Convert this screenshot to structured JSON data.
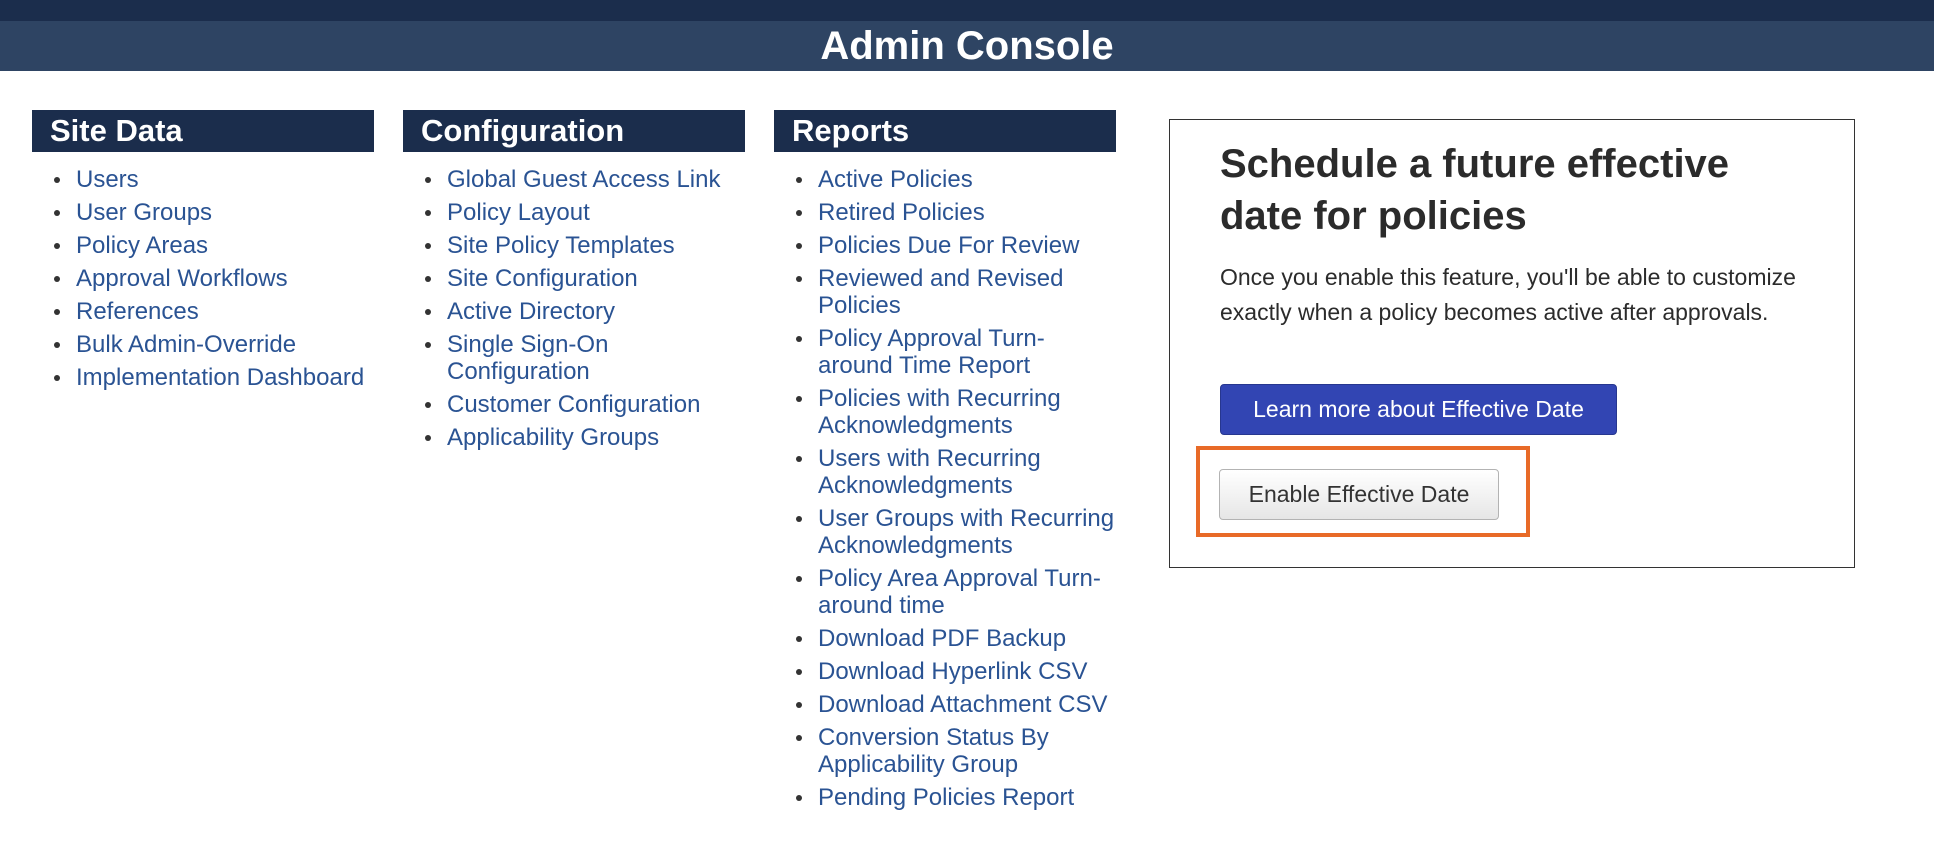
{
  "header": {
    "title": "Admin Console"
  },
  "site_data": {
    "heading": "Site Data",
    "items": [
      {
        "label": "Users"
      },
      {
        "label": "User Groups"
      },
      {
        "label": "Policy Areas"
      },
      {
        "label": "Approval Workflows"
      },
      {
        "label": "References"
      },
      {
        "label": "Bulk Admin-Override"
      },
      {
        "label": "Implementation Dashboard"
      }
    ]
  },
  "configuration": {
    "heading": "Configuration",
    "items": [
      {
        "label": "Global Guest Access Link"
      },
      {
        "label": "Policy Layout"
      },
      {
        "label": "Site Policy Templates"
      },
      {
        "label": "Site Configuration"
      },
      {
        "label": "Active Directory"
      },
      {
        "label": "Single Sign-On Configuration"
      },
      {
        "label": "Customer Configuration"
      },
      {
        "label": "Applicability Groups"
      }
    ]
  },
  "reports": {
    "heading": "Reports",
    "items": [
      {
        "label": "Active Policies"
      },
      {
        "label": "Retired Policies"
      },
      {
        "label": "Policies Due For Review"
      },
      {
        "label": "Reviewed and Revised Policies"
      },
      {
        "label": "Policy Approval Turn-around Time Report"
      },
      {
        "label": "Policies with Recurring Acknowledgments"
      },
      {
        "label": "Users with Recurring Acknowledgments"
      },
      {
        "label": "User Groups with Recurring Acknowledgments"
      },
      {
        "label": "Policy Area Approval Turn-around time"
      },
      {
        "label": "Download PDF Backup"
      },
      {
        "label": "Download Hyperlink CSV"
      },
      {
        "label": "Download Attachment CSV"
      },
      {
        "label": "Conversion Status By Applicability Group"
      },
      {
        "label": "Pending Policies Report"
      }
    ]
  },
  "feature_card": {
    "title": "Schedule a future effective date for policies",
    "description": "Once you enable this feature, you'll be able to customize exactly when a policy becomes active after approvals.",
    "learn_more_label": "Learn more about Effective Date",
    "enable_label": "Enable Effective Date"
  },
  "colors": {
    "header_dark": "#1b2d4c",
    "header_band": "#2e4463",
    "link": "#2a5393",
    "primary_button": "#3245b3",
    "highlight": "#e86a27"
  }
}
